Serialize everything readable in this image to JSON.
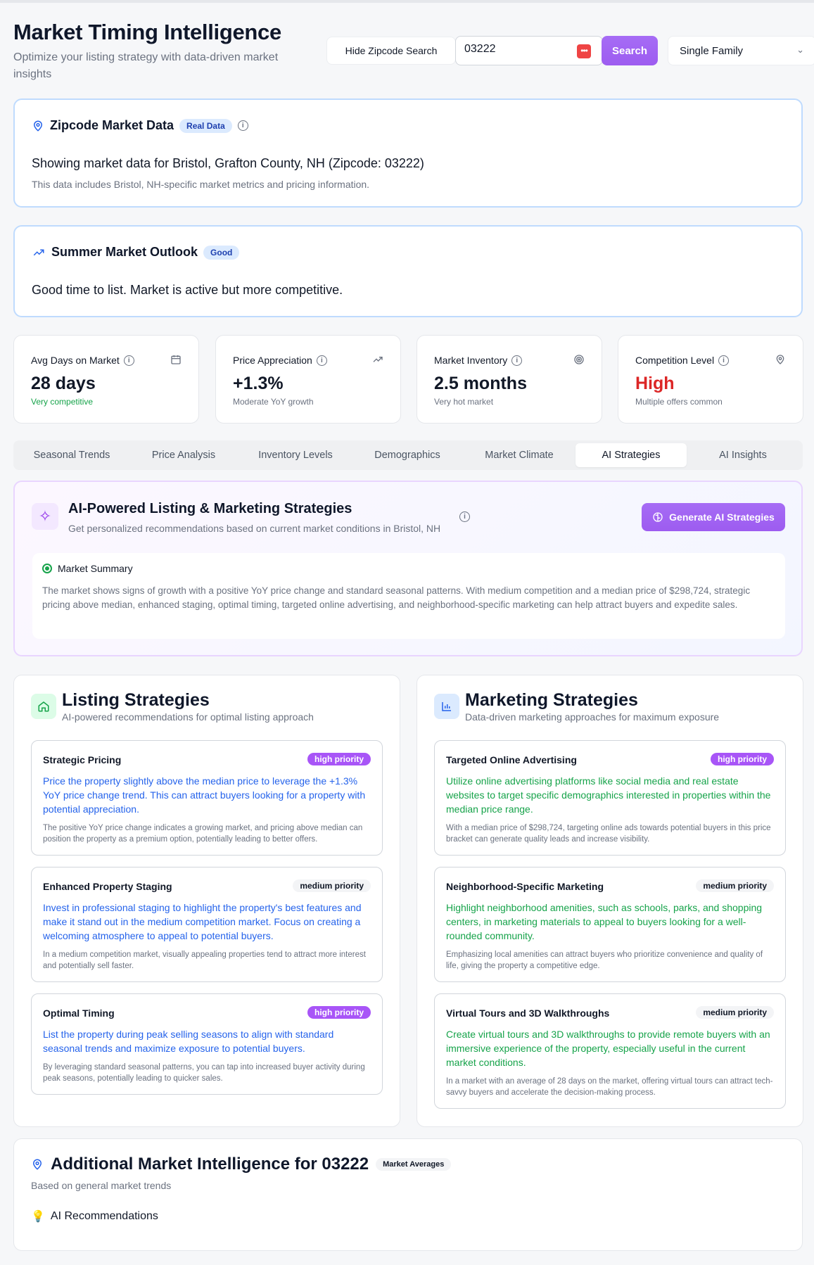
{
  "header": {
    "title": "Market Timing Intelligence",
    "subtitle": "Optimize your listing strategy with data-driven market insights",
    "hide_zip_label": "Hide Zipcode Search",
    "zip_value": "03222",
    "search_label": "Search",
    "property_type": "Single Family"
  },
  "zip_card": {
    "title": "Zipcode Market Data",
    "badge": "Real Data",
    "main": "Showing market data for Bristol, Grafton County, NH (Zipcode: 03222)",
    "sub": "This data includes Bristol, NH-specific market metrics and pricing information."
  },
  "outlook": {
    "title": "Summer Market Outlook",
    "badge": "Good",
    "text": "Good time to list. Market is active but more competitive."
  },
  "stats": [
    {
      "label": "Avg Days on Market",
      "value": "28 days",
      "desc": "Very competitive",
      "icon": "calendar-icon"
    },
    {
      "label": "Price Appreciation",
      "value": "+1.3%",
      "desc": "Moderate YoY growth",
      "icon": "trend-up-icon"
    },
    {
      "label": "Market Inventory",
      "value": "2.5 months",
      "desc": "Very hot market",
      "icon": "target-icon"
    },
    {
      "label": "Competition Level",
      "value": "High",
      "desc": "Multiple offers common",
      "icon": "location-pin-icon"
    }
  ],
  "tabs": [
    "Seasonal Trends",
    "Price Analysis",
    "Inventory Levels",
    "Demographics",
    "Market Climate",
    "AI Strategies",
    "AI Insights"
  ],
  "active_tab": "AI Strategies",
  "ai": {
    "title": "AI-Powered Listing & Marketing Strategies",
    "subtitle": "Get personalized recommendations based on current market conditions in Bristol, NH",
    "generate_label": "Generate AI Strategies",
    "summary_title": "Market Summary",
    "summary_text": "The market shows signs of growth with a positive YoY price change and standard seasonal patterns. With medium competition and a median price of $298,724, strategic pricing above median, enhanced staging, optimal timing, targeted online advertising, and neighborhood-specific marketing can help attract buyers and expedite sales."
  },
  "listing": {
    "title": "Listing Strategies",
    "subtitle": "AI-powered recommendations for optimal listing approach",
    "items": [
      {
        "title": "Strategic Pricing",
        "priority": "high priority",
        "body": "Price the property slightly above the median price to leverage the +1.3% YoY price change trend. This can attract buyers looking for a property with potential appreciation.",
        "note": "The positive YoY price change indicates a growing market, and pricing above median can position the property as a premium option, potentially leading to better offers."
      },
      {
        "title": "Enhanced Property Staging",
        "priority": "medium priority",
        "body": "Invest in professional staging to highlight the property's best features and make it stand out in the medium competition market. Focus on creating a welcoming atmosphere to appeal to potential buyers.",
        "note": "In a medium competition market, visually appealing properties tend to attract more interest and potentially sell faster."
      },
      {
        "title": "Optimal Timing",
        "priority": "high priority",
        "body": "List the property during peak selling seasons to align with standard seasonal trends and maximize exposure to potential buyers.",
        "note": "By leveraging standard seasonal patterns, you can tap into increased buyer activity during peak seasons, potentially leading to quicker sales."
      }
    ]
  },
  "marketing": {
    "title": "Marketing Strategies",
    "subtitle": "Data-driven marketing approaches for maximum exposure",
    "items": [
      {
        "title": "Targeted Online Advertising",
        "priority": "high priority",
        "body": "Utilize online advertising platforms like social media and real estate websites to target specific demographics interested in properties within the median price range.",
        "note": "With a median price of $298,724, targeting online ads towards potential buyers in this price bracket can generate quality leads and increase visibility."
      },
      {
        "title": "Neighborhood-Specific Marketing",
        "priority": "medium priority",
        "body": "Highlight neighborhood amenities, such as schools, parks, and shopping centers, in marketing materials to appeal to buyers looking for a well-rounded community.",
        "note": "Emphasizing local amenities can attract buyers who prioritize convenience and quality of life, giving the property a competitive edge."
      },
      {
        "title": "Virtual Tours and 3D Walkthroughs",
        "priority": "medium priority",
        "body": "Create virtual tours and 3D walkthroughs to provide remote buyers with an immersive experience of the property, especially useful in the current market conditions.",
        "note": "In a market with an average of 28 days on the market, offering virtual tours can attract tech-savvy buyers and accelerate the decision-making process."
      }
    ]
  },
  "additional": {
    "title": "Additional Market Intelligence for 03222",
    "badge": "Market Averages",
    "subtitle": "Based on general market trends",
    "rec_title": "AI Recommendations"
  },
  "colors": {
    "accent_purple": "#a66cf5",
    "blue_text": "#2563eb",
    "green_text": "#16a34a",
    "red_value": "#dc2626"
  }
}
